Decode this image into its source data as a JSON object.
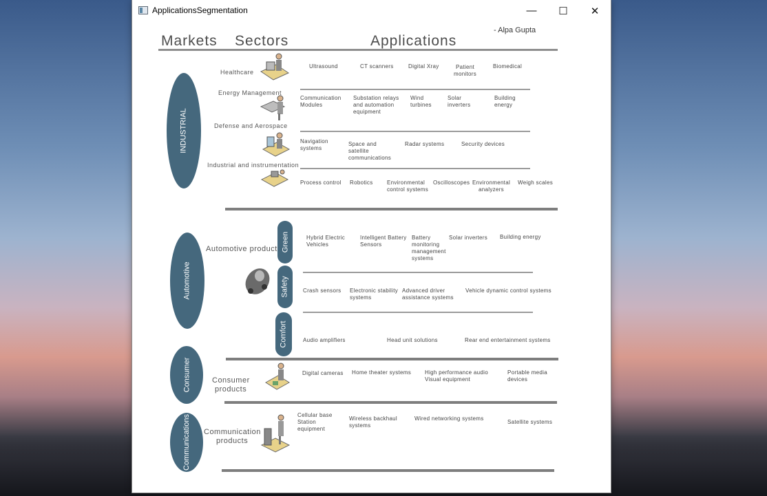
{
  "window": {
    "title": "ApplicationsSegmentation"
  },
  "controls": {
    "minimize": "—",
    "maximize": "☐",
    "close": "✕"
  },
  "header": {
    "markets": "Markets",
    "sectors": "Sectors",
    "applications": "Applications",
    "author": "- Alpa Gupta"
  },
  "markets": {
    "industrial": "INDUSTRIAL",
    "automotive": "Automotive",
    "consumer": "Consumer",
    "communications": "Communications"
  },
  "sectors": {
    "healthcare": "Healthcare",
    "energy": "Energy Management",
    "defense": "Defense and Aerospace",
    "industrial_instr": "Industrial and instrumentation",
    "automotive_products": "Automotive products",
    "consumer_products_1": "Consumer",
    "consumer_products_2": "products",
    "communication_products_1": "Communication",
    "communication_products_2": "products"
  },
  "subsectors": {
    "green": "Green",
    "safety": "Safety",
    "comfort": "Comfort"
  },
  "apps": {
    "healthcare": [
      "Ultrasound",
      "CT scanners",
      "Digital Xray",
      "Patient\nmonitors",
      "Biomedical"
    ],
    "energy": [
      "Communication\nModules",
      "Substation relays\nand automation\nequipment",
      "Wind\nturbines",
      "Solar\ninverters",
      "Building\nenergy"
    ],
    "defense": [
      "Navigation\nsystems",
      "Space and\nsatellite\ncommunications",
      "Radar systems",
      "Security devices"
    ],
    "industrial": [
      "Process control",
      "Robotics",
      "Environmental\ncontrol systems",
      "Oscilloscopes",
      "Environmental\nanalyzers",
      "Weigh scales"
    ],
    "green": [
      "Hybrid Electric\nVehicles",
      "Intelligent Battery\nSensors",
      "Battery\nmonitoring\nmanagement\nsystems",
      "Solar inverters",
      "Building energy"
    ],
    "safety": [
      "Crash sensors",
      "Electronic stability\nsystems",
      "Advanced driver\nassistance systems",
      "Vehicle dynamic control systems"
    ],
    "comfort": [
      "Audio amplifiers",
      "Head unit solutions",
      "Rear end entertainment systems"
    ],
    "consumer": [
      "Digital cameras",
      "Home theater systems",
      "High performance audio\nVisual equipment",
      "Portable media\ndevices"
    ],
    "communications": [
      "Cellular base\nStation\nequipment",
      "Wireless backhaul\nsystems",
      "Wired networking systems",
      "Satellite systems"
    ]
  },
  "colors": {
    "market_fill": "#45687d",
    "rule": "#8f8f8f"
  }
}
